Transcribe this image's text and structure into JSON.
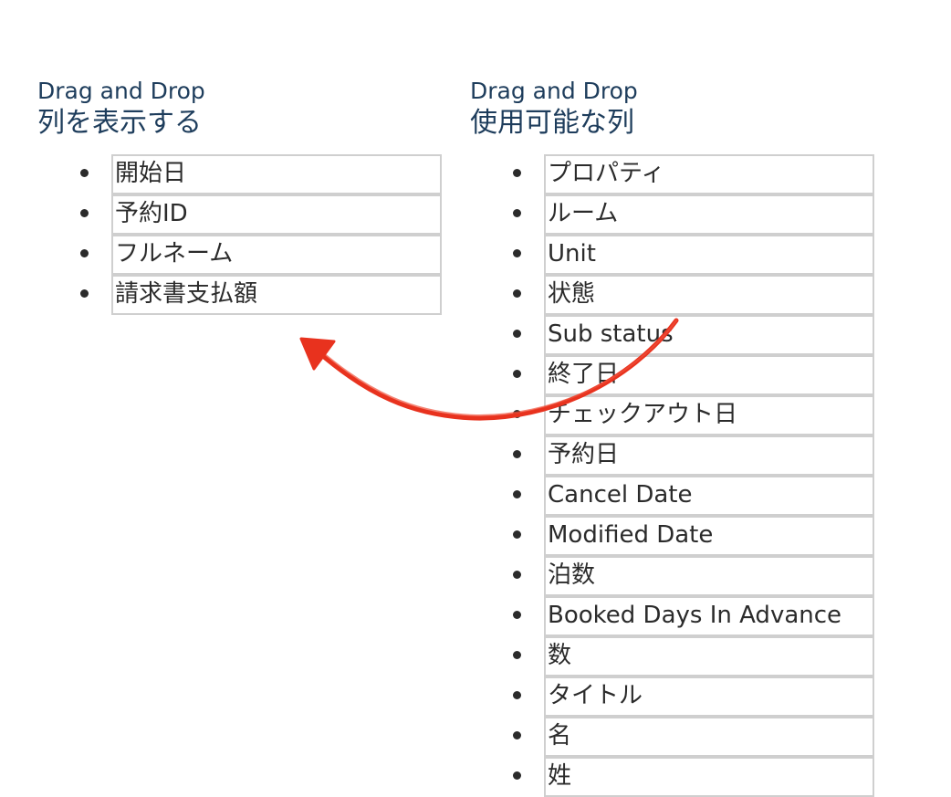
{
  "left_panel": {
    "hint": "Drag and Drop",
    "title": "列を表示する",
    "items": [
      {
        "label": "開始日"
      },
      {
        "label": "予約ID"
      },
      {
        "label": "フルネーム"
      },
      {
        "label": "請求書支払額"
      }
    ]
  },
  "right_panel": {
    "hint": "Drag and Drop",
    "title": "使用可能な列",
    "items": [
      {
        "label": "プロパティ"
      },
      {
        "label": "ルーム"
      },
      {
        "label": "Unit"
      },
      {
        "label": "状態"
      },
      {
        "label": "Sub status"
      },
      {
        "label": "終了日"
      },
      {
        "label": "チェックアウト日"
      },
      {
        "label": "予約日"
      },
      {
        "label": "Cancel Date"
      },
      {
        "label": "Modified Date"
      },
      {
        "label": "泊数"
      },
      {
        "label": "Booked Days In Advance"
      },
      {
        "label": "数"
      },
      {
        "label": "タイトル"
      },
      {
        "label": "名"
      },
      {
        "label": "姓"
      }
    ]
  },
  "annotation": {
    "icon": "curved-arrow-icon",
    "color": "#e8321e"
  }
}
